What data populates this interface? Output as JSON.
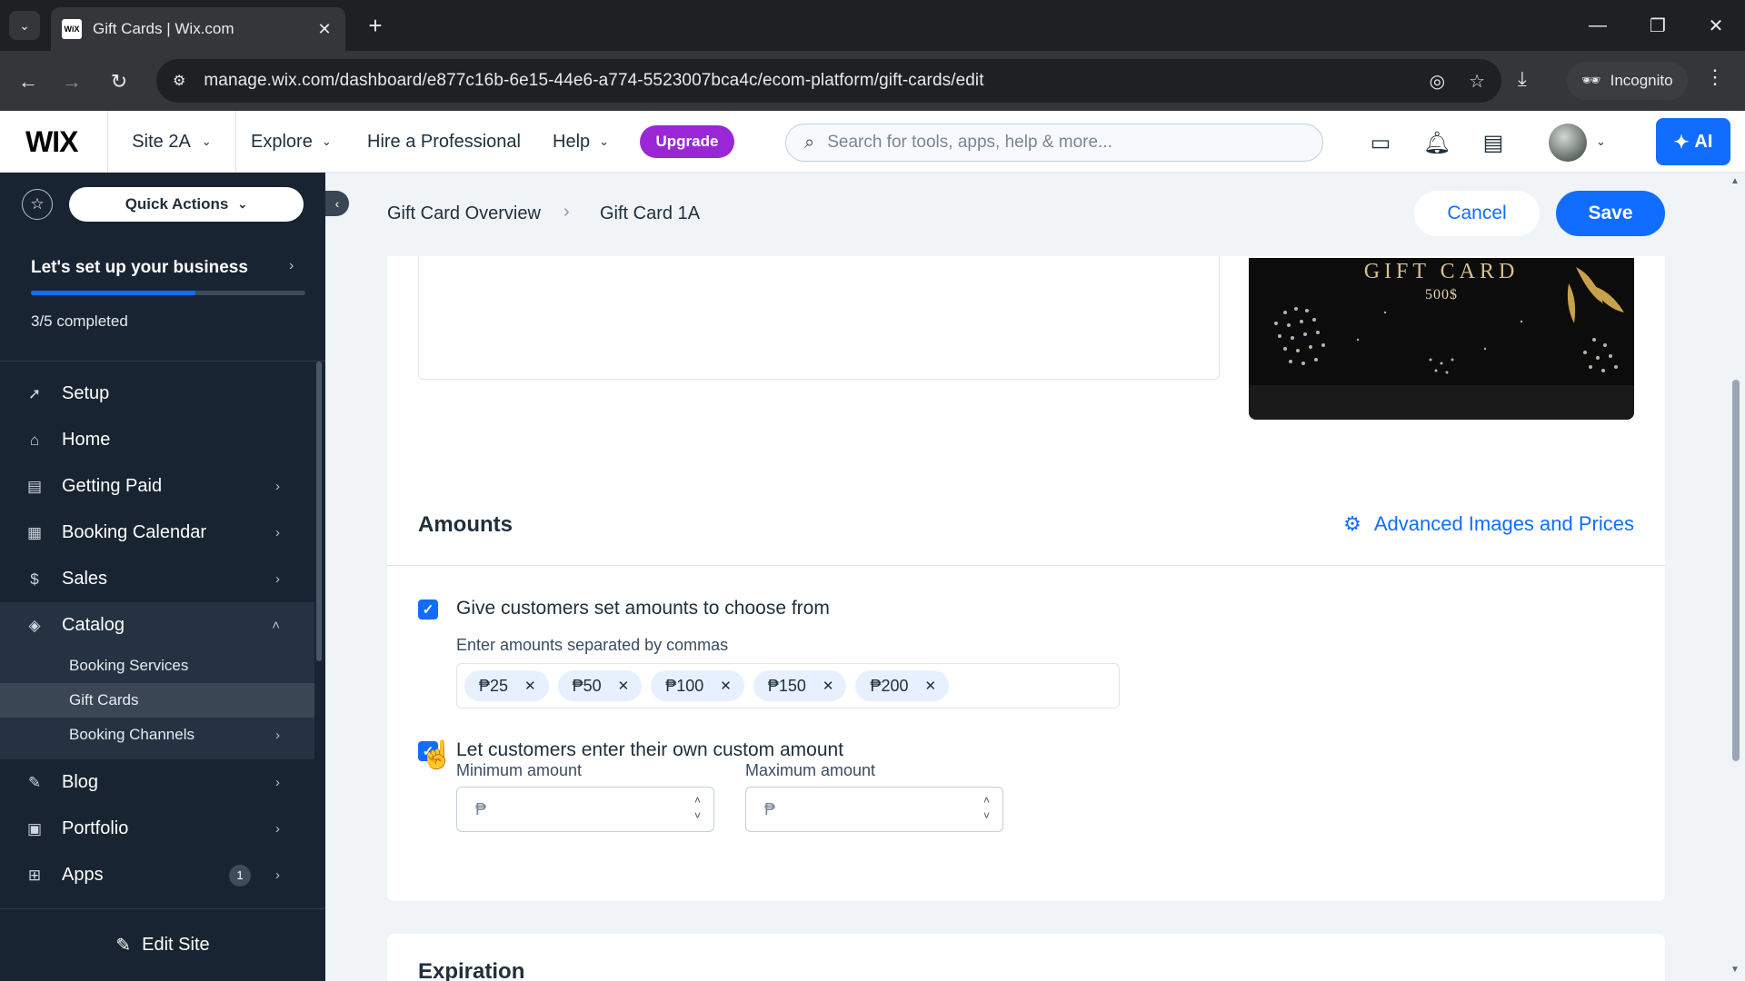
{
  "browser": {
    "tab_title": "Gift Cards | Wix.com",
    "favicon_text": "WiX",
    "url": "manage.wix.com/dashboard/e877c16b-6e15-44e6-a774-5523007bca4c/ecom-platform/gift-cards/edit",
    "incognito_label": "Incognito"
  },
  "header": {
    "logo": "WIX",
    "site_name": "Site 2A",
    "nav": {
      "explore": "Explore",
      "hire": "Hire a Professional",
      "help": "Help"
    },
    "upgrade_label": "Upgrade",
    "search_placeholder": "Search for tools, apps, help & more...",
    "ai_label": "AI"
  },
  "sidebar": {
    "quick_actions": "Quick Actions",
    "setup": {
      "title": "Let's set up your business",
      "progress_completed": 3,
      "progress_total": 5,
      "count_label": "3/5 completed"
    },
    "items": [
      {
        "label": "Setup",
        "icon": "rocket-icon",
        "glyph": "➚"
      },
      {
        "label": "Home",
        "icon": "home-icon",
        "glyph": "⌂"
      },
      {
        "label": "Getting Paid",
        "icon": "document-icon",
        "glyph": "▤"
      },
      {
        "label": "Booking Calendar",
        "icon": "calendar-icon",
        "glyph": "▦"
      },
      {
        "label": "Sales",
        "icon": "dollar-icon",
        "glyph": "$"
      },
      {
        "label": "Catalog",
        "icon": "box-icon",
        "glyph": "◈"
      }
    ],
    "catalog_sub": [
      {
        "label": "Booking Services"
      },
      {
        "label": "Gift Cards"
      },
      {
        "label": "Booking Channels"
      }
    ],
    "items_after": [
      {
        "label": "Blog",
        "icon": "pen-icon",
        "glyph": "✎"
      },
      {
        "label": "Portfolio",
        "icon": "portfolio-icon",
        "glyph": "▣"
      },
      {
        "label": "Apps",
        "icon": "apps-icon",
        "glyph": "⊞",
        "badge": "1"
      }
    ],
    "edit_site": "Edit Site"
  },
  "page": {
    "breadcrumb_parent": "Gift Card Overview",
    "breadcrumb_current": "Gift Card 1A",
    "cancel_label": "Cancel",
    "save_label": "Save",
    "gift_card_image": {
      "title": "GIFT CARD",
      "amount": "500$"
    },
    "amounts": {
      "title": "Amounts",
      "advanced_link": "Advanced Images and Prices",
      "set_amounts_label": "Give customers set amounts to choose from",
      "set_amounts_checked": true,
      "amounts_field_label": "Enter amounts separated by commas",
      "tags": [
        "₱25",
        "₱50",
        "₱100",
        "₱150",
        "₱200"
      ],
      "custom_amount_label": "Let customers enter their own custom amount",
      "custom_amount_checked": true,
      "min_label": "Minimum amount",
      "max_label": "Maximum amount",
      "currency_symbol": "₱"
    },
    "expiration_title": "Expiration"
  },
  "colors": {
    "accent": "#116dff",
    "upgrade": "#9a27d5",
    "sidebar_bg": "#182431"
  }
}
